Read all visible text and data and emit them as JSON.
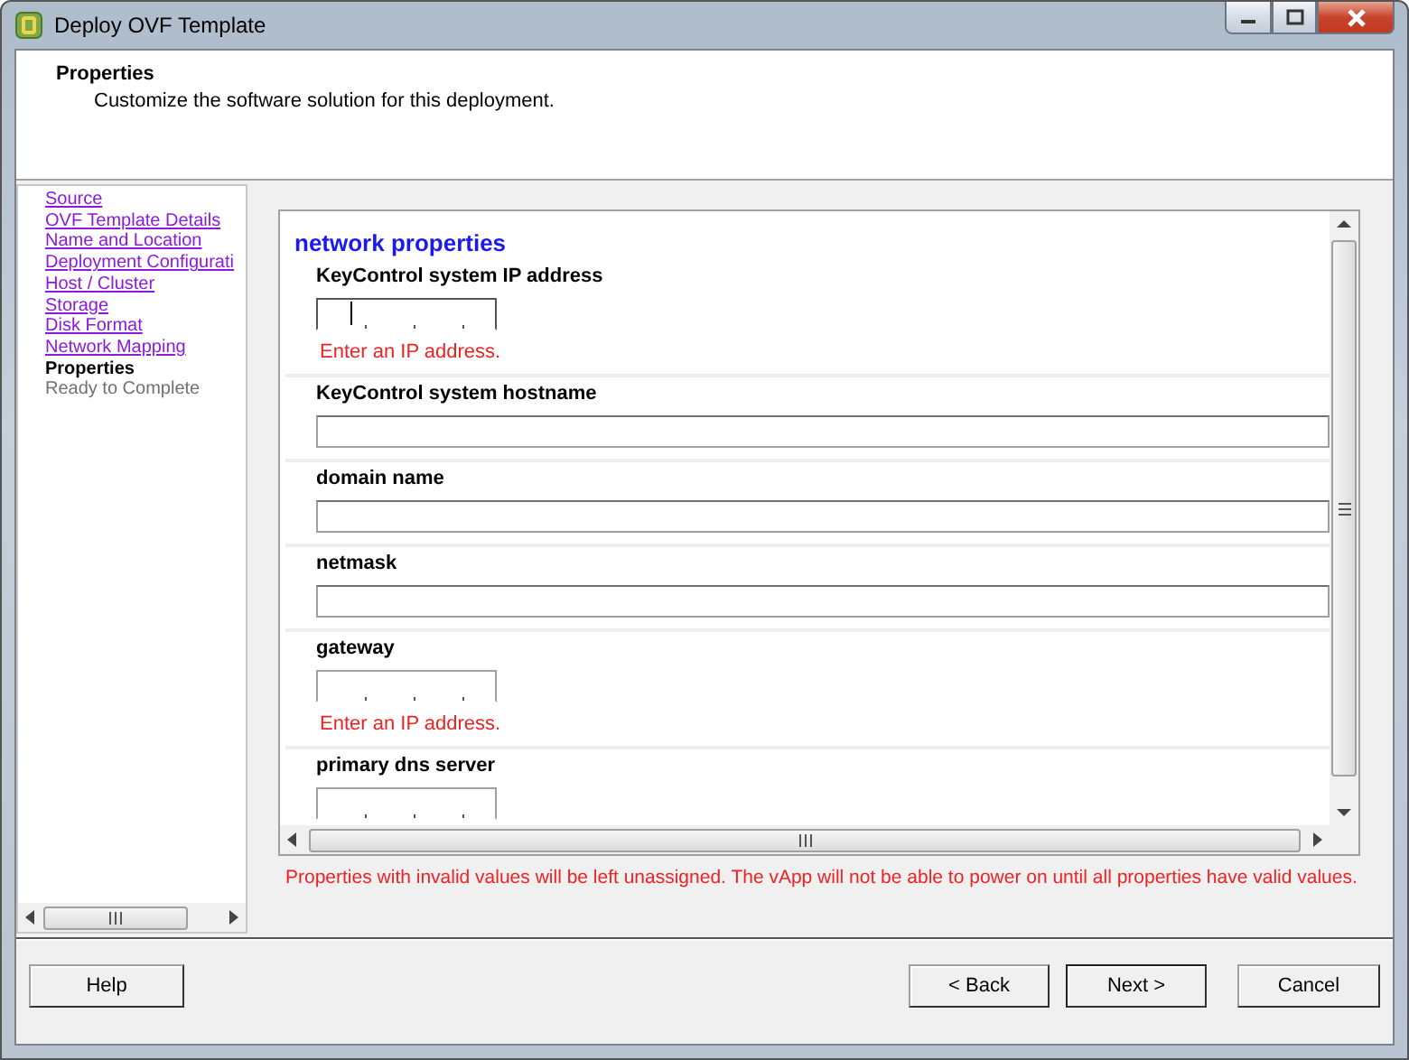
{
  "window": {
    "title": "Deploy OVF Template"
  },
  "header": {
    "title": "Properties",
    "subtitle": "Customize the software solution for this deployment."
  },
  "steps": [
    {
      "label": "Source",
      "selected": false,
      "disabled": false
    },
    {
      "label": "OVF Template Details",
      "selected": false,
      "disabled": false
    },
    {
      "label": "Name and Location",
      "selected": false,
      "disabled": false
    },
    {
      "label": "Deployment Configurati",
      "selected": false,
      "disabled": false
    },
    {
      "label": "Host / Cluster",
      "selected": false,
      "disabled": false
    },
    {
      "label": "Storage",
      "selected": false,
      "disabled": false
    },
    {
      "label": "Disk Format",
      "selected": false,
      "disabled": false
    },
    {
      "label": "Network Mapping",
      "selected": false,
      "disabled": false
    },
    {
      "label": "Properties",
      "selected": true,
      "disabled": false
    },
    {
      "label": "Ready to Complete",
      "selected": false,
      "disabled": true
    }
  ],
  "properties": {
    "heading": "network properties",
    "fields": [
      {
        "label": "KeyControl system IP address",
        "kind": "ip",
        "focused": true,
        "error": "Enter an IP address."
      },
      {
        "label": "KeyControl system hostname",
        "kind": "text",
        "focused": false
      },
      {
        "label": "domain name",
        "kind": "text",
        "focused": false
      },
      {
        "label": "netmask",
        "kind": "text",
        "focused": false
      },
      {
        "label": "gateway",
        "kind": "ip",
        "focused": false,
        "error": "Enter an IP address."
      },
      {
        "label": "primary dns server",
        "kind": "ip",
        "focused": false
      }
    ]
  },
  "warning": "Properties with invalid values will be left unassigned. The vApp will not be able to power on until all properties have valid values.",
  "buttons": [
    {
      "label": "Help",
      "kind": "help",
      "default": false
    },
    {
      "label": "< Back",
      "kind": "nav",
      "default": false
    },
    {
      "label": "Next >",
      "kind": "nav",
      "default": true
    },
    {
      "label": "Cancel",
      "kind": "cancel",
      "default": false
    }
  ]
}
